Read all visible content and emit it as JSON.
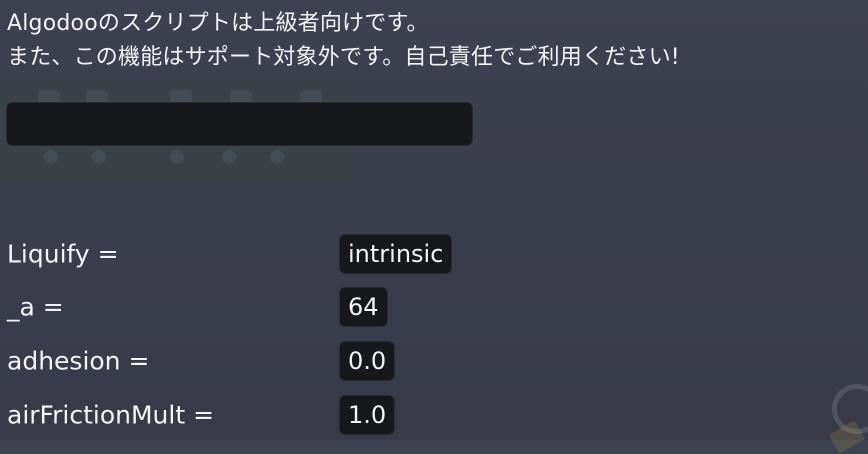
{
  "warning": {
    "line1": "Algodooのスクリプトは上級者向けです。",
    "line2": "また、この機能はサポート対象外です。自己責任でご利用ください!"
  },
  "script_input": {
    "value": ""
  },
  "properties": [
    {
      "name": "Liquify =",
      "value": "intrinsic"
    },
    {
      "name": "_a =",
      "value": "64"
    },
    {
      "name": "adhesion =",
      "value": "0.0"
    },
    {
      "name": "airFrictionMult =",
      "value": "1.0"
    }
  ]
}
